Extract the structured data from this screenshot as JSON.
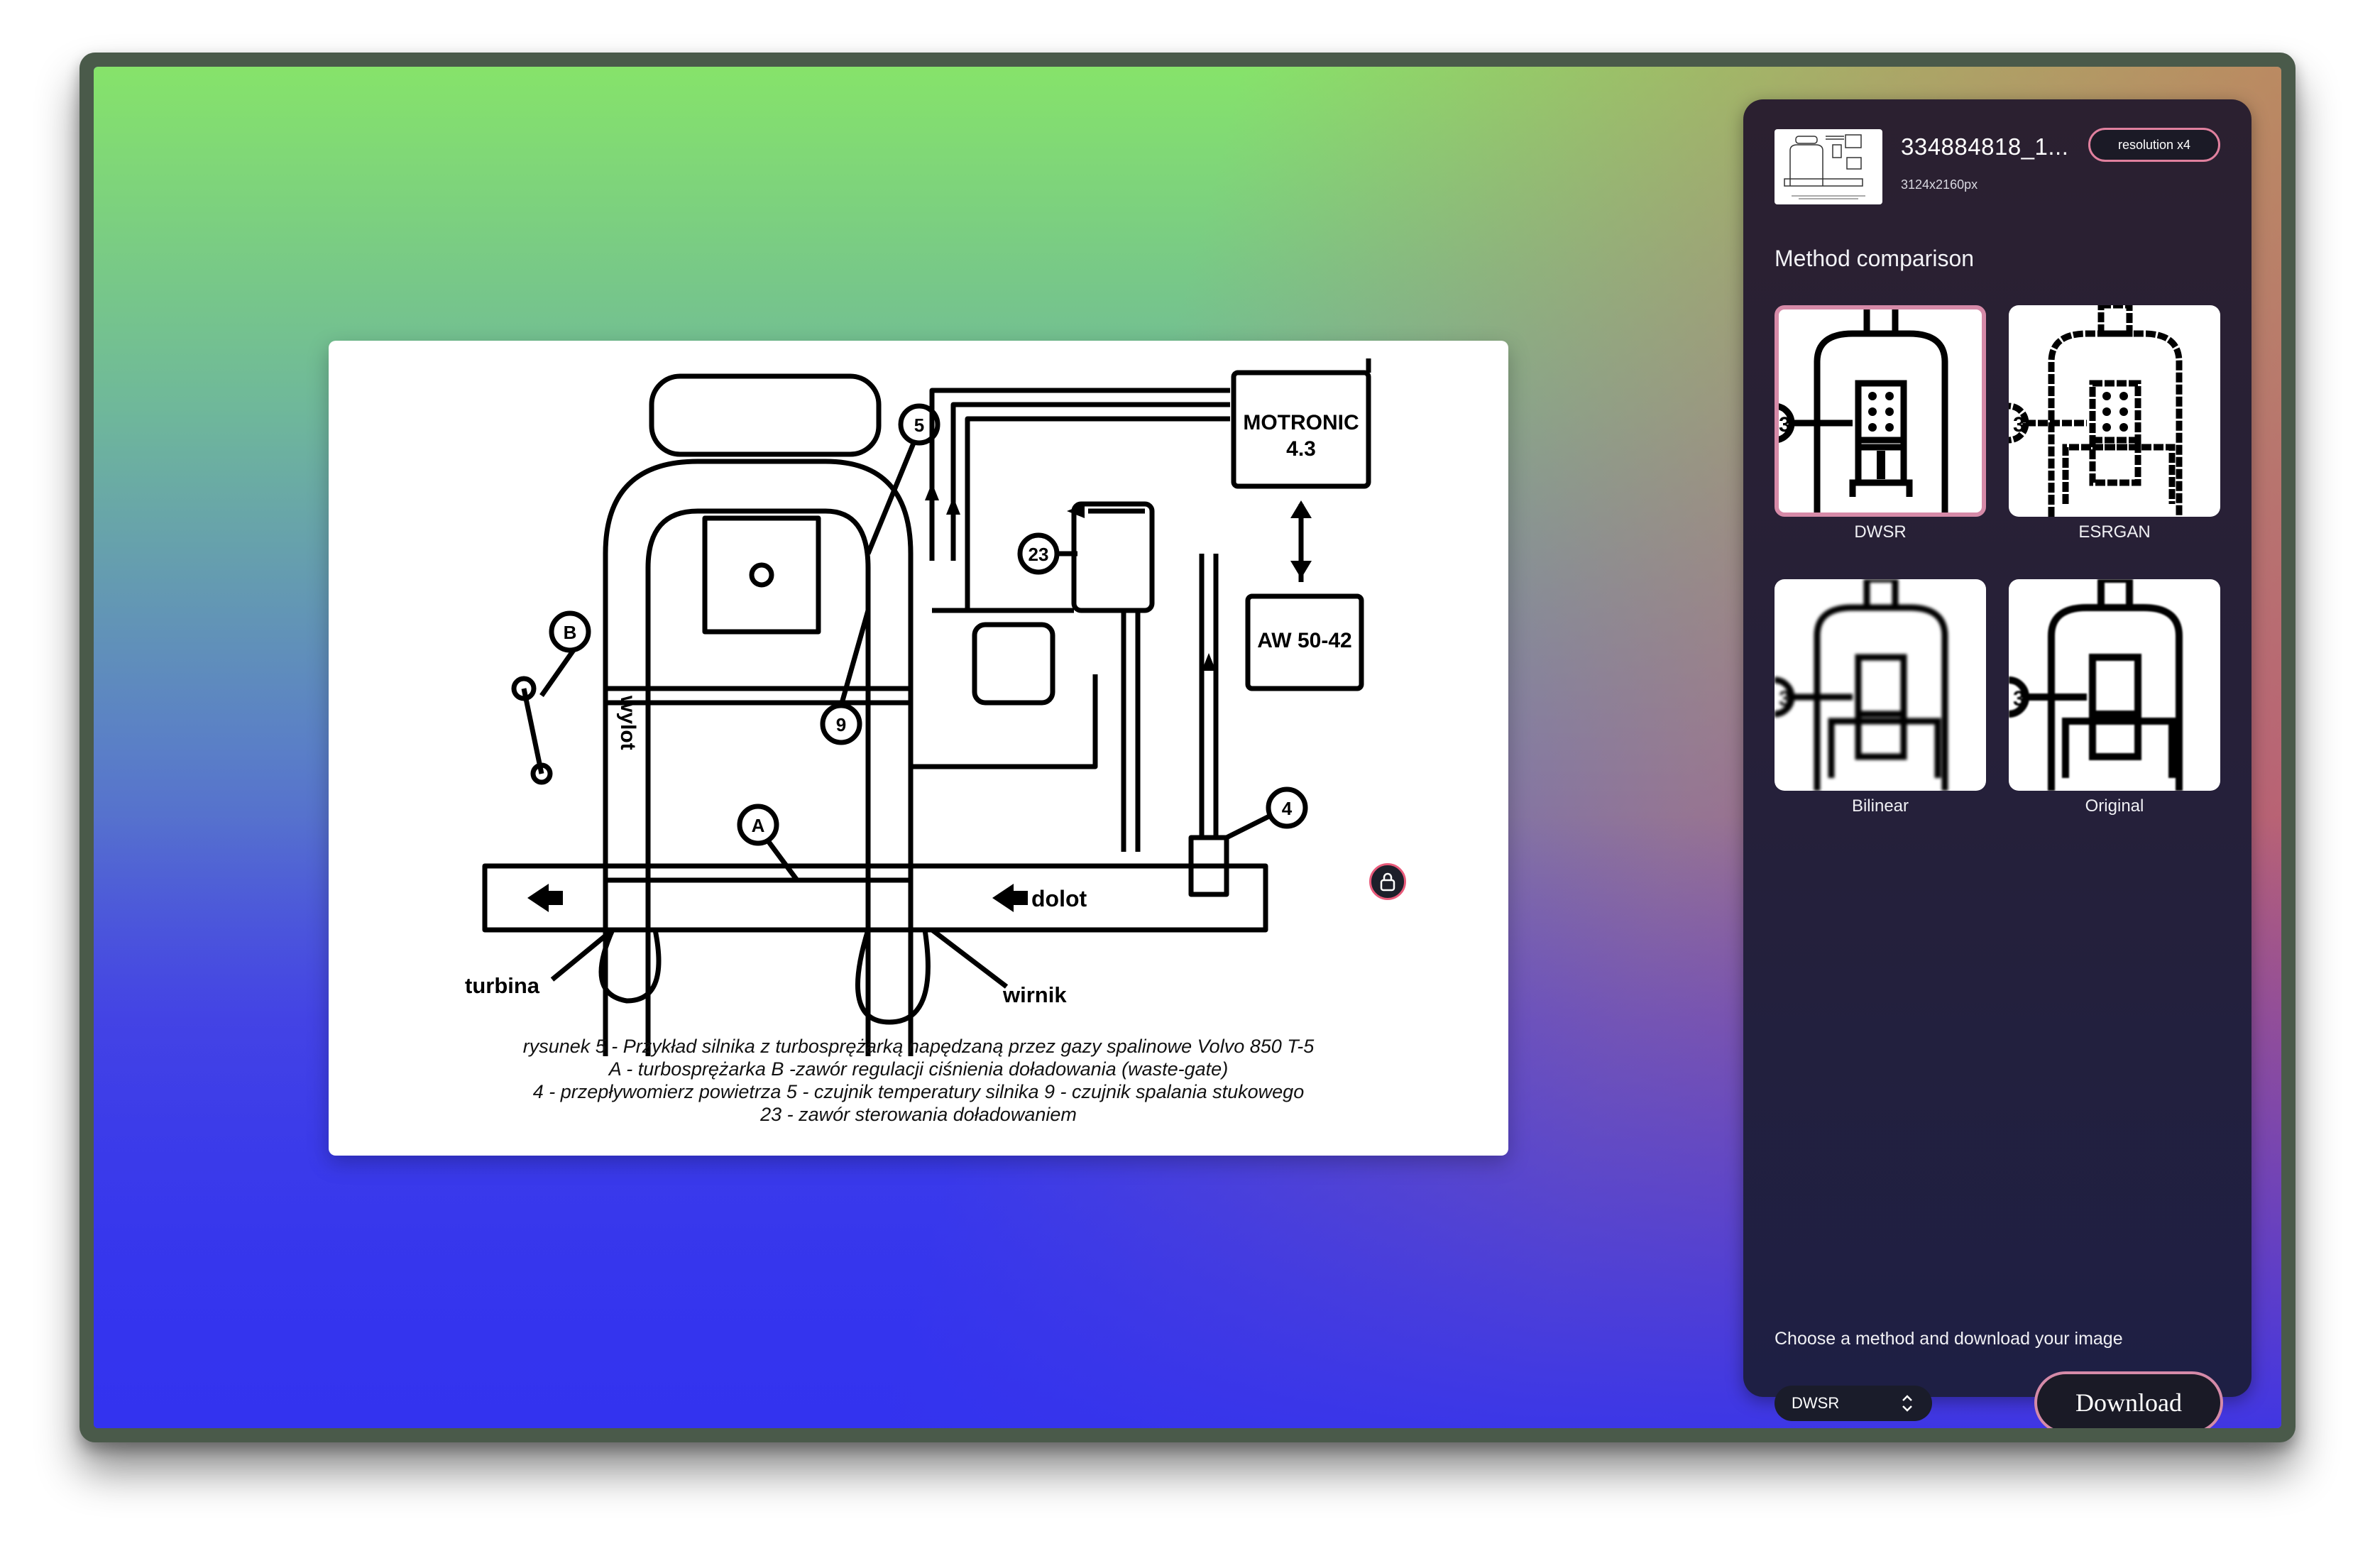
{
  "file": {
    "name": "334884818_1...",
    "dimensions": "3124x2160px",
    "resolution_badge": "resolution x4"
  },
  "comparison": {
    "title": "Method comparison",
    "methods": [
      {
        "label": "DWSR",
        "selected": true
      },
      {
        "label": "ESRGAN",
        "selected": false
      },
      {
        "label": "Bilinear",
        "selected": false
      },
      {
        "label": "Original",
        "selected": false
      }
    ]
  },
  "footer": {
    "prompt": "Choose a method and download your image",
    "selected_method": "DWSR",
    "download_label": "Download"
  },
  "diagram": {
    "labels": {
      "motronic": "MOTRONIC",
      "motronic_version": "4.3",
      "aw": "AW 50-42",
      "wylot": "wylot",
      "dolot": "dolot",
      "turbina": "turbina",
      "wirnik": "wirnik",
      "c5": "5",
      "c9": "9",
      "c23": "23",
      "cB": "B",
      "cA": "A",
      "c4": "4"
    },
    "caption": [
      "rysunek 5 - Przykład silnika z turbosprężarką napędzaną przez gazy spalinowe Volvo 850 T-5",
      "A - turbosprężarka   B -zawór regulacji ciśnienia doładowania (waste-gate)",
      "4 - przepływomierz powietrza  5 - czujnik temperatury silnika  9 - czujnik spalania stukowego",
      "23 - zawór sterowania doładowaniem"
    ]
  },
  "colors": {
    "accent": "#d68aa8",
    "panel": "#25203a"
  }
}
